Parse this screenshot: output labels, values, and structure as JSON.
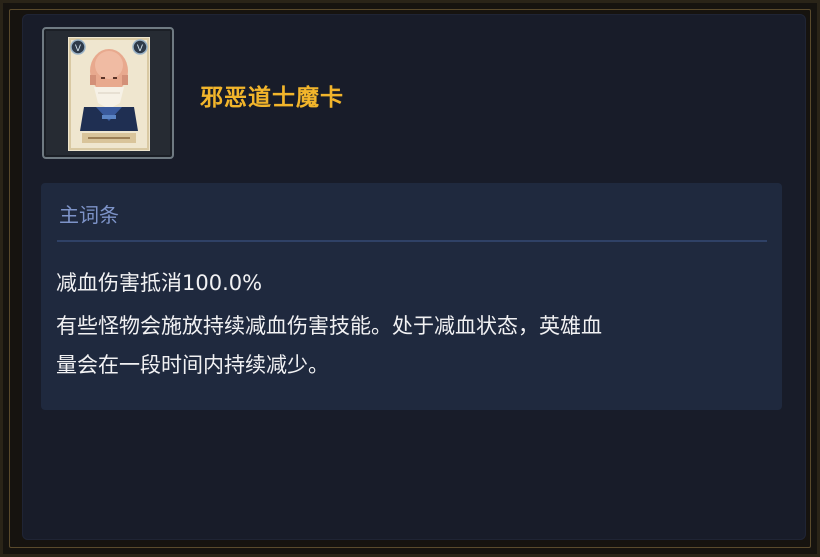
{
  "item": {
    "name": "邪恶道士魔卡",
    "icon": "evil-taoist-card-icon",
    "name_color": "#f2b52b"
  },
  "affix": {
    "header": "主词条",
    "effect": "减血伤害抵消100.0%",
    "description_line1": "有些怪物会施放持续减血伤害技能。处于减血状态，英雄血",
    "description_line2": "量会在一段时间内持续减少。"
  }
}
